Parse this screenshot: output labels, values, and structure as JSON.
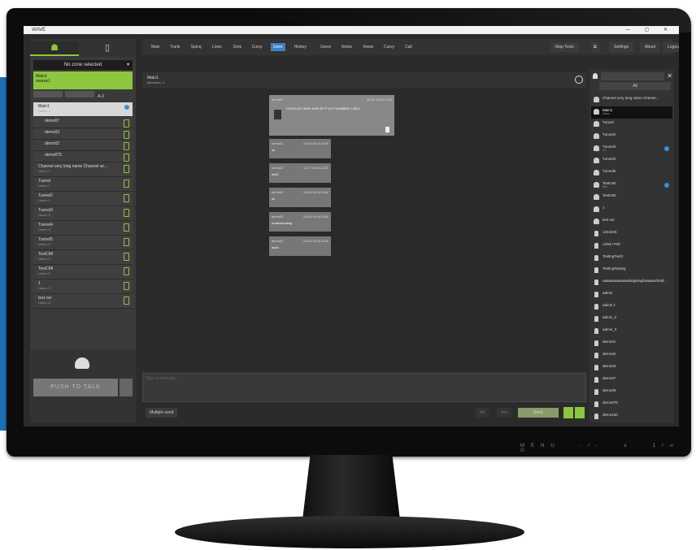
{
  "window": {
    "title": "WAVE",
    "controls": "— ▢ ✕"
  },
  "left_panel": {
    "zone_select": "No zone selected",
    "zone_box_lines": [
      "Main1",
      "avaree1"
    ],
    "sort_label": "A-Z",
    "channels": [
      {
        "name": "Main1",
        "sub": "Users: 4",
        "selected": true,
        "indicator": "dot"
      },
      {
        "name": "demo07",
        "sub": "",
        "small": true,
        "indicator": "mic"
      },
      {
        "name": "demo03",
        "sub": "",
        "small": true,
        "indicator": "mic"
      },
      {
        "name": "demo02",
        "sub": "",
        "small": true,
        "indicator": "mic"
      },
      {
        "name": "demo075",
        "sub": "",
        "small": true,
        "indicator": "mic"
      },
      {
        "name": "Channel very long name Channel ve...",
        "sub": "Users: 0",
        "indicator": "speaker"
      },
      {
        "name": "Tunnel",
        "sub": "Users: 1",
        "indicator": "speaker"
      },
      {
        "name": "Tunnel2",
        "sub": "Users: 0",
        "indicator": "speaker"
      },
      {
        "name": "Tunnel3",
        "sub": "Users: 0",
        "indicator": "speaker"
      },
      {
        "name": "Tunnel4",
        "sub": "Users: 0",
        "indicator": "speaker"
      },
      {
        "name": "Tunnel5",
        "sub": "Users: 0",
        "indicator": "speaker"
      },
      {
        "name": "TestCMI",
        "sub": "Users: 0",
        "indicator": "speaker"
      },
      {
        "name": "TestCMI",
        "sub": "Users: 0",
        "indicator": "speaker"
      },
      {
        "name": "1",
        "sub": "Users: 0",
        "indicator": "speaker"
      },
      {
        "name": "test ver",
        "sub": "Users: 0",
        "indicator": "speaker"
      }
    ],
    "ptt_label": "PUSH TO TALK"
  },
  "menubar": {
    "items": [
      "Main",
      "Trunk",
      "Spinq",
      "Lines",
      "Dots",
      "Curvy",
      "Lines",
      "History",
      "Users",
      "Notes",
      "Views",
      "Curvy",
      "Call"
    ],
    "active_index": 6,
    "right_buttons": [
      "Map Tools",
      "Settings",
      "About",
      "Logout"
    ]
  },
  "chat": {
    "title": "Main1",
    "subtitle": "Members: 4",
    "messages": [
      {
        "from": "demo07",
        "time": "09:48 19.04.2016",
        "text": "DOCKLIST 8993 4939 2ETTJ-ET NUMBER 1-8821",
        "attachment": true
      },
      {
        "from": "demo02",
        "time": "13:45 19.04.2016",
        "text": "ok"
      },
      {
        "from": "demo02",
        "time": "13:47 19.04.2016",
        "text": "test2"
      },
      {
        "from": "demo02",
        "time": "13:48 19.04.2016",
        "text": "ok"
      },
      {
        "from": "demo02",
        "time": "13:50 19.04.2016",
        "text": "understanding"
      },
      {
        "from": "demo02",
        "time": "13:55 19.04.2016",
        "text": "asda"
      }
    ],
    "input_placeholder": "Type a message...",
    "bottom_left_button": "Multiple send",
    "send_label": "Send",
    "aux_labels": [
      "No",
      "Yes"
    ]
  },
  "right_panel": {
    "search_placeholder": "",
    "filter_label": "All",
    "contacts": [
      {
        "name": "Channel very long name Channe...",
        "type": "channel"
      },
      {
        "name": "Main1",
        "sub": "Users",
        "type": "channel",
        "selected": true
      },
      {
        "name": "Tunnel",
        "type": "channel"
      },
      {
        "name": "Tunnel2",
        "type": "channel"
      },
      {
        "name": "Tunnel3",
        "sub": "14",
        "type": "channel",
        "dot": true
      },
      {
        "name": "Tunnel4",
        "type": "channel"
      },
      {
        "name": "Tunnel5",
        "type": "channel"
      },
      {
        "name": "TestCMI",
        "sub": "test",
        "type": "channel",
        "dot": true
      },
      {
        "name": "TestCMI",
        "type": "channel"
      },
      {
        "name": "1",
        "type": "channel"
      },
      {
        "name": "test ver",
        "type": "channel"
      },
      {
        "name": "1234235",
        "type": "person"
      },
      {
        "name": "Admin Pell",
        "type": "person"
      },
      {
        "name": "TestingTest3",
        "type": "person"
      },
      {
        "name": "TestingTesting",
        "type": "person"
      },
      {
        "name": "aaaaaaaaaaaaabegininghaaaaacheld...",
        "type": "person"
      },
      {
        "name": "admin",
        "type": "person"
      },
      {
        "name": "admin 1",
        "type": "person"
      },
      {
        "name": "admin_2",
        "type": "person"
      },
      {
        "name": "admin_3",
        "type": "person"
      },
      {
        "name": "demo01",
        "type": "person"
      },
      {
        "name": "demo02",
        "type": "person"
      },
      {
        "name": "demo03",
        "type": "person"
      },
      {
        "name": "demo07",
        "type": "person"
      },
      {
        "name": "demo08",
        "type": "person"
      },
      {
        "name": "demo075",
        "type": "person"
      },
      {
        "name": "demo100",
        "type": "person"
      }
    ]
  },
  "monitor_buttons": [
    "MENU",
    "-/-",
    "∨",
    "1/∞",
    "⏻"
  ],
  "colors": {
    "accent": "#8dc63f",
    "active_tab": "#3d7fc0",
    "unread": "#3b8fd6"
  }
}
